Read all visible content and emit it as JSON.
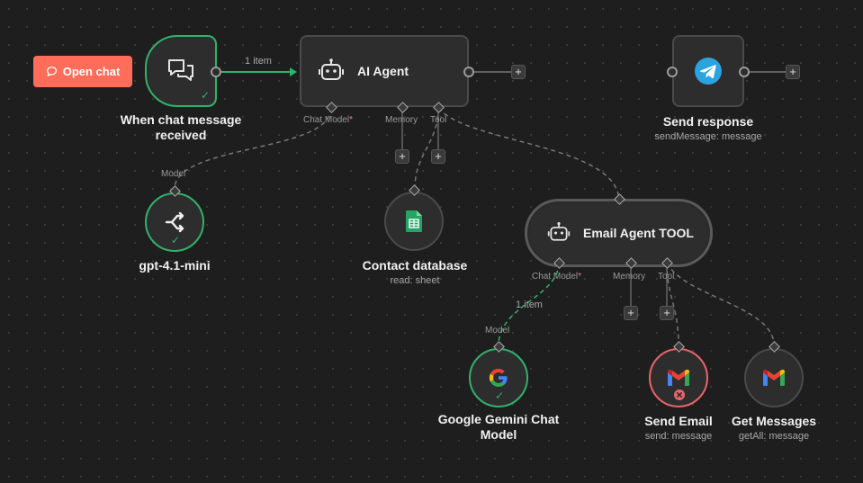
{
  "trigger": {
    "button_label": "Open chat",
    "title": "When chat message received",
    "edge_label": "1 item"
  },
  "ai_agent": {
    "title": "AI Agent",
    "ports": {
      "chat_model": "Chat Model",
      "memory": "Memory",
      "tool": "Tool"
    }
  },
  "send_response": {
    "title": "Send response",
    "subtitle": "sendMessage: message"
  },
  "gpt": {
    "port_label": "Model",
    "title": "gpt-4.1-mini"
  },
  "contact_db": {
    "title": "Contact database",
    "subtitle": "read: sheet"
  },
  "email_agent": {
    "title": "Email Agent TOOL",
    "ports": {
      "chat_model": "Chat Model",
      "memory": "Memory",
      "tool": "Tool"
    },
    "edge_label": "1 item"
  },
  "gemini": {
    "port_label": "Model",
    "title": "Google Gemini Chat Model"
  },
  "send_email": {
    "title": "Send Email",
    "subtitle": "send: message"
  },
  "get_messages": {
    "title": "Get Messages",
    "subtitle": "getAll: message"
  },
  "required_mark": "*",
  "plus_glyph": "+",
  "check_glyph": "✓",
  "colors": {
    "success": "#2fb36b",
    "error": "#e9646b",
    "button": "#ff6d5a",
    "telegram": "#2aa3df",
    "sheets": "#22a565"
  }
}
